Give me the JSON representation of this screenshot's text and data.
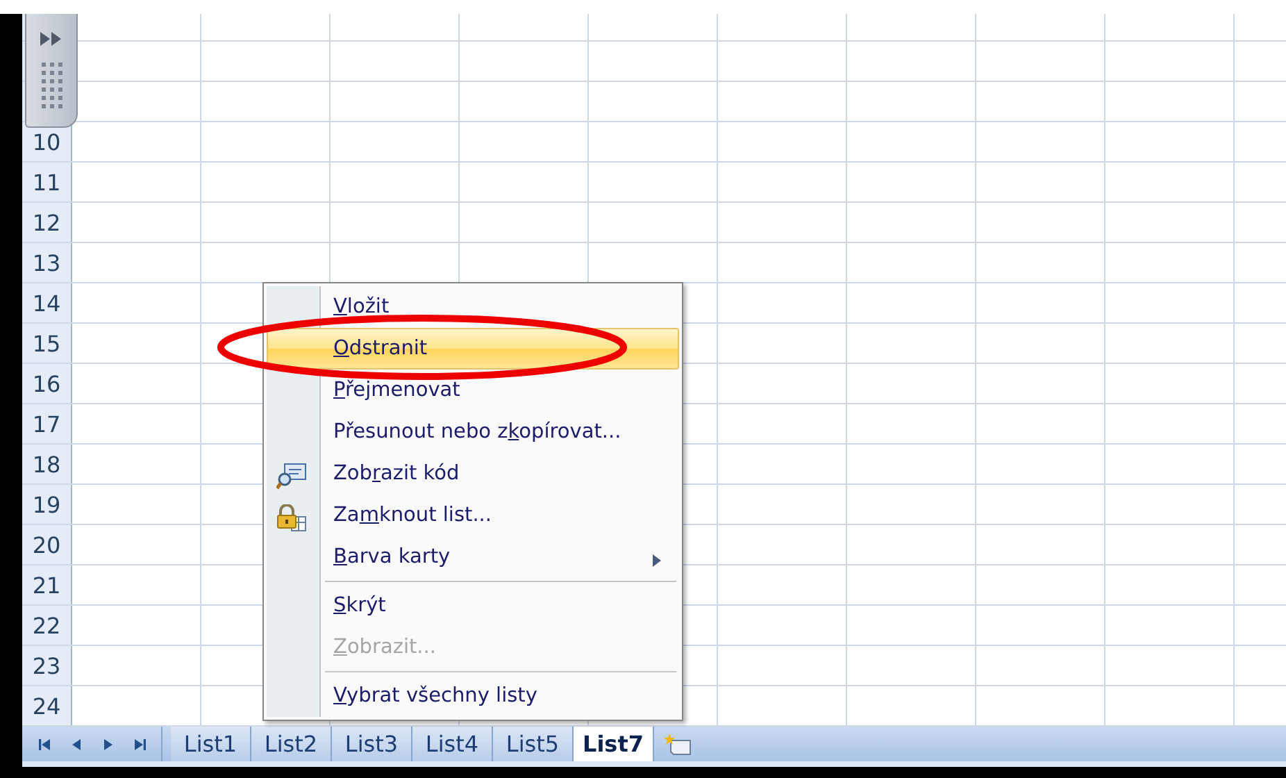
{
  "rows": [
    "10",
    "11",
    "12",
    "13",
    "14",
    "15",
    "16",
    "17",
    "18",
    "19",
    "20",
    "21",
    "22",
    "23",
    "24"
  ],
  "context_menu": {
    "items": [
      {
        "kind": "item",
        "key": "V",
        "after": "ložit",
        "selected": false,
        "disabled": false
      },
      {
        "kind": "item",
        "key": "O",
        "after": "dstranit",
        "selected": true,
        "disabled": false
      },
      {
        "kind": "item",
        "key": "P",
        "after": "řejmenovat",
        "selected": false,
        "disabled": false
      },
      {
        "kind": "item",
        "before": "Přesunout nebo z",
        "key": "k",
        "after": "opírovat...",
        "selected": false,
        "disabled": false
      },
      {
        "kind": "viewcode",
        "before": "Zob",
        "key": "r",
        "after": "azit kód",
        "selected": false,
        "disabled": false
      },
      {
        "kind": "protect",
        "before": "Za",
        "key": "m",
        "after": "knout list...",
        "selected": false,
        "disabled": false
      },
      {
        "kind": "submenu",
        "key": "B",
        "after": "arva karty",
        "selected": false,
        "disabled": false
      },
      {
        "kind": "separator"
      },
      {
        "kind": "item",
        "key": "S",
        "after": "krýt",
        "selected": false,
        "disabled": false
      },
      {
        "kind": "item",
        "key": "Z",
        "after": "obrazit...",
        "selected": false,
        "disabled": true
      },
      {
        "kind": "separator"
      },
      {
        "kind": "item",
        "key": "V",
        "after": "ybrat všechny listy",
        "selected": false,
        "disabled": false
      }
    ]
  },
  "sheet_tabs": [
    {
      "label": "List1",
      "selected": false
    },
    {
      "label": "List2",
      "selected": false
    },
    {
      "label": "List3",
      "selected": false
    },
    {
      "label": "List4",
      "selected": false
    },
    {
      "label": "List5",
      "selected": false
    },
    {
      "label": "List7",
      "selected": true
    }
  ]
}
